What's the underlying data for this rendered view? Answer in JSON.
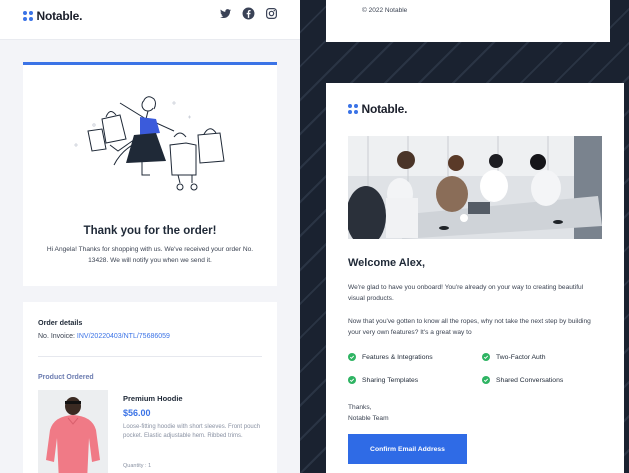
{
  "brand": {
    "name": "Notable.",
    "accent": "#3b73e6",
    "dark_bg": "#1b2330"
  },
  "left_email": {
    "social_icons": [
      "twitter-icon",
      "facebook-icon",
      "instagram-icon"
    ],
    "thanks": {
      "title": "Thank you for the order!",
      "body": "Hi Angela! Thanks for shopping with us. We've received your order No. 13428. We will notify you when we send it."
    },
    "order_details": {
      "title": "Order details",
      "invoice_label": "No. Invoice: ",
      "invoice_link": "INV/20220403/NTL/75686059"
    },
    "product_ordered": {
      "title": "Product Ordered",
      "name": "Premium Hoodie",
      "price": "$56.00",
      "description": "Loose-fitting hoodie with short sleeves. Front pouch pocket. Elastic adjustable hem. Ribbed trims.",
      "quantity": "Quantity : 1"
    }
  },
  "right_email": {
    "footer_copyright": "© 2022 Notable",
    "welcome_title": "Welcome Alex,",
    "para1": "We're glad to have you onboard! You're already on your way to creating beautiful visual products.",
    "para2": "Now that you've gotten to know all the ropes, why not take the next step by building your very own features? It's a great way to",
    "features": [
      "Features & Integrations",
      "Two-Factor Auth",
      "Sharing Templates",
      "Shared Conversations"
    ],
    "signoff_line1": "Thanks,",
    "signoff_line2": "Notable Team",
    "cta_label": "Confirm Email Address",
    "check_color": "#2fb463"
  }
}
